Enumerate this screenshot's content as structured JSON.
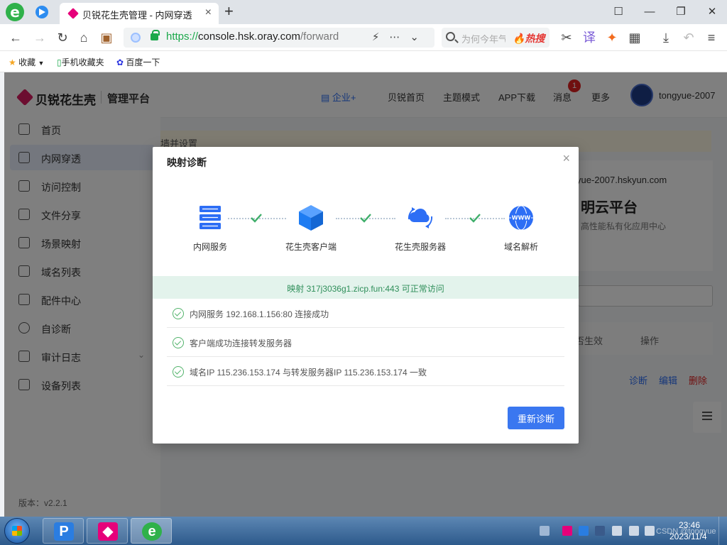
{
  "browser": {
    "logo_glyph": "e",
    "tab": {
      "title": "贝锐花生壳管理 - 内网穿透",
      "close": "×"
    },
    "new_tab": "+",
    "window_controls": [
      "☐",
      "—",
      "❐",
      "✕"
    ],
    "address": {
      "protocol": "https://",
      "host": "console.hsk.oray.com",
      "path": "/forward"
    },
    "search": {
      "placeholder": "为何今年气",
      "hot_label": "🔥热搜"
    },
    "bookmarks": {
      "favorites": "收藏",
      "mobile": "手机收藏夹",
      "baidu": "百度一下"
    }
  },
  "app": {
    "brand": {
      "name": "贝锐花生壳",
      "sub": "管理平台"
    },
    "menu": [
      {
        "label": "首页",
        "active": false
      },
      {
        "label": "内网穿透",
        "active": true
      },
      {
        "label": "访问控制",
        "active": false
      },
      {
        "label": "文件分享",
        "active": false
      },
      {
        "label": "场景映射",
        "active": false
      },
      {
        "label": "域名列表",
        "active": false
      },
      {
        "label": "配件中心",
        "active": false
      },
      {
        "label": "自诊断",
        "active": false
      },
      {
        "label": "审计日志",
        "active": false
      },
      {
        "label": "设备列表",
        "active": false
      }
    ],
    "version": "版本：v2.2.1",
    "topnav": {
      "enterprise": "企业+",
      "home": "贝锐首页",
      "theme": "主题模式",
      "app_download": "APP下载",
      "messages": "消息",
      "message_count": "1",
      "more": "更多",
      "user": "tongyue-2007"
    },
    "notice_text": "墙并设置",
    "panel": {
      "domain": "yue-2007.hskyun.com",
      "cloud_title": "明云平台",
      "cloud_sub": "高性能私有化应用中心"
    },
    "table_headers": [
      "否生效",
      "操作"
    ],
    "row_actions": {
      "diagnose": "诊断",
      "edit": "编辑",
      "delete": "删除"
    }
  },
  "dialog": {
    "title": "映射诊断",
    "close": "×",
    "steps": [
      {
        "label": "内网服务",
        "icon": "server-icon"
      },
      {
        "label": "花生壳客户端",
        "icon": "cube-icon"
      },
      {
        "label": "花生壳服务器",
        "icon": "cloud-sync-icon"
      },
      {
        "label": "域名解析",
        "icon": "www-globe-icon"
      }
    ],
    "status": "映射 317j3036g1.zicp.fun:443 可正常访问",
    "results": [
      "内网服务 192.168.1.156:80 连接成功",
      "客户端成功连接转发服务器",
      "域名IP 115.236.153.174 与转发服务器IP 115.236.153.174 一致"
    ],
    "rediagnose_label": "重新诊断"
  },
  "taskbar": {
    "time": "23:46",
    "date": "2023/11/4",
    "watermark": "CSDN @tongyue"
  },
  "colors": {
    "accent": "#3a77f0",
    "success": "#52b36b",
    "brand": "#d81b60"
  }
}
